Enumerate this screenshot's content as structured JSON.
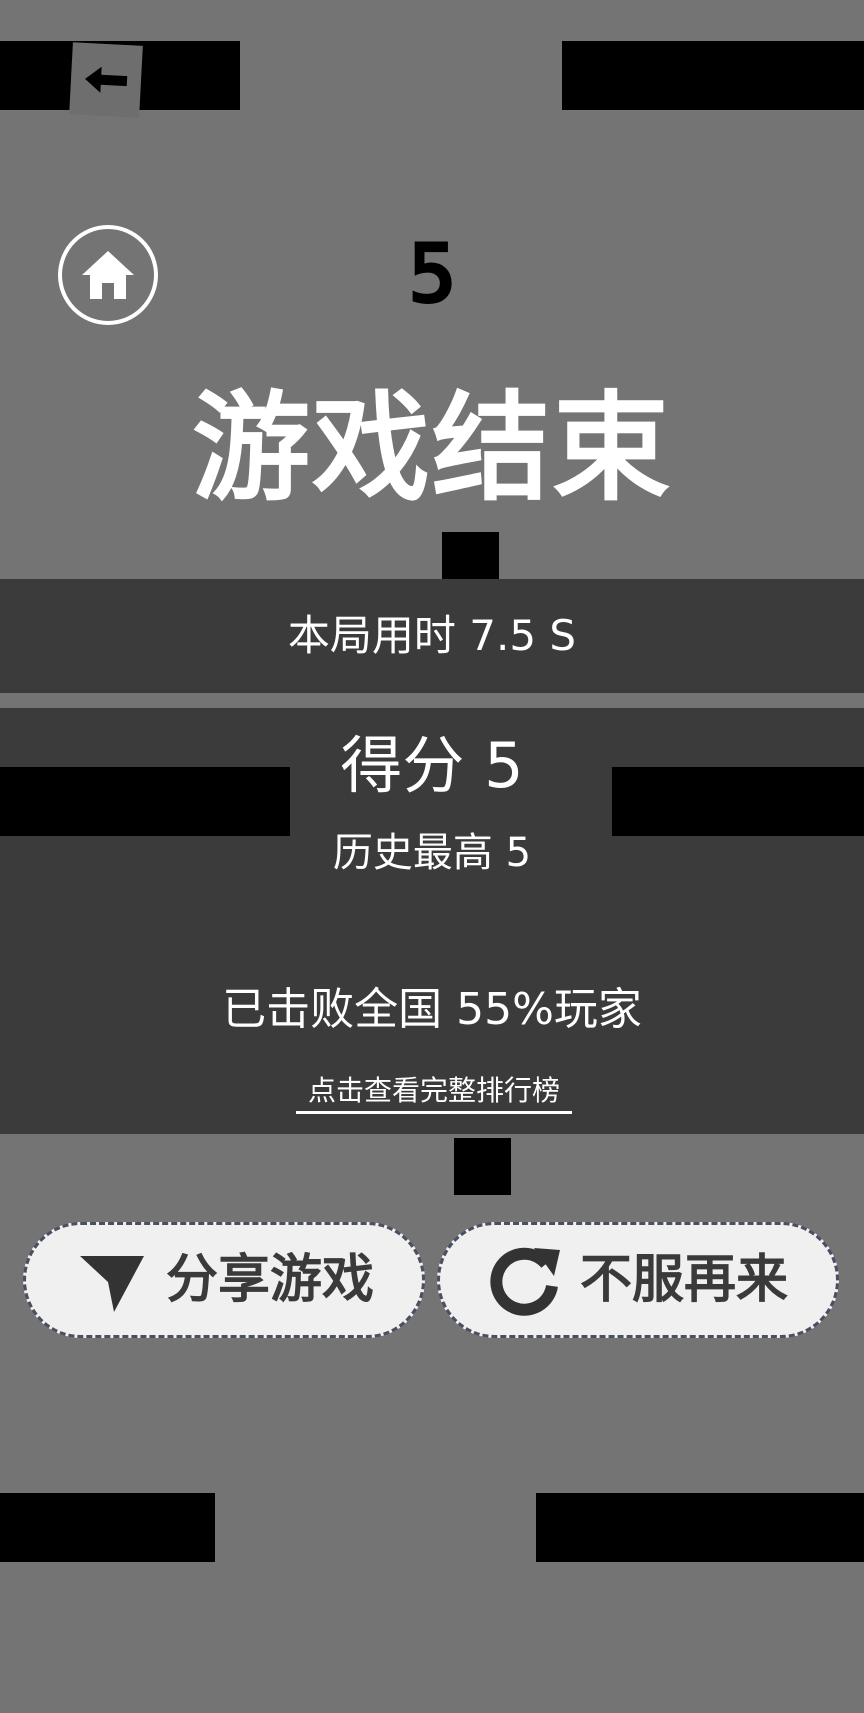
{
  "game": {
    "current_score": "5",
    "title": "游戏结束"
  },
  "result": {
    "time_label": "本局用时 7.5 S",
    "score_label": "得分 5",
    "best_label": "历史最高 5",
    "defeat_label": "已击败全国 55%玩家",
    "leaderboard_link": "点击查看完整排行榜"
  },
  "buttons": {
    "share": {
      "label": "分享游戏",
      "icon": "send-icon"
    },
    "retry": {
      "label": "不服再来",
      "icon": "refresh-icon"
    },
    "home": {
      "icon": "home-icon"
    },
    "back": {
      "icon": "arrow-left-icon"
    }
  },
  "colors": {
    "background": "#747474",
    "panel": "#3b3b3b",
    "obstacle": "#000000",
    "text": "#ffffff",
    "button_bg": "#f0f0f0",
    "button_text": "#3a3a3a"
  }
}
